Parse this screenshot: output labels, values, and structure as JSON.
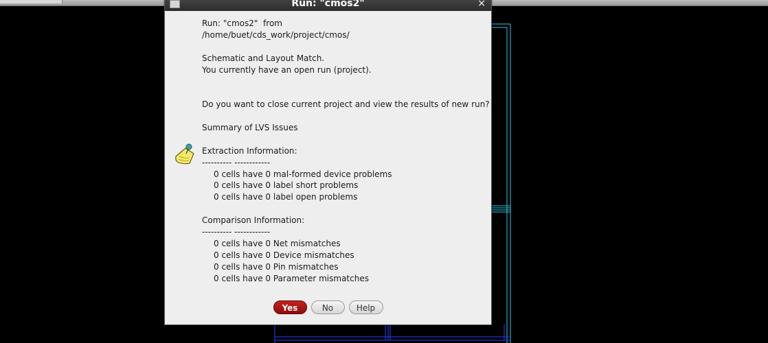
{
  "dialog": {
    "title": "Run: \"cmos2\"",
    "close_symbol": "×",
    "lines": [
      "Run: \"cmos2\"  from",
      "/home/buet/cds_work/project/cmos/",
      "",
      "Schematic and Layout Match.",
      "You currently have an open run (project).",
      "",
      "",
      "Do you want to close current project and view the results of new run?",
      "",
      "Summary of LVS Issues",
      "",
      "Extraction Information:",
      "---------- ------------",
      "0 cells have 0 mal-formed device problems",
      "0 cells have 0 label short problems",
      "0 cells have 0 label open problems",
      "",
      "Comparison Information:",
      "---------- ------------",
      "0 cells have 0 Net mismatches",
      "0 cells have 0 Device mismatches",
      "0 cells have 0 Pin mismatches",
      "0 cells have 0 Parameter mismatches"
    ],
    "buttons": {
      "yes": "Yes",
      "no": "No",
      "help": "Help"
    },
    "icons": {
      "window_menu": "window-menu-icon",
      "note": "note-pin-icon",
      "close": "close-icon"
    }
  },
  "colors": {
    "canvas_background": "#000000",
    "layout_line_cyan": "#33c9e6",
    "layout_line_blue": "#2a3cff",
    "dialog_background": "#eeeeee",
    "title_bar": "#333333",
    "primary_button": "#b01818"
  }
}
